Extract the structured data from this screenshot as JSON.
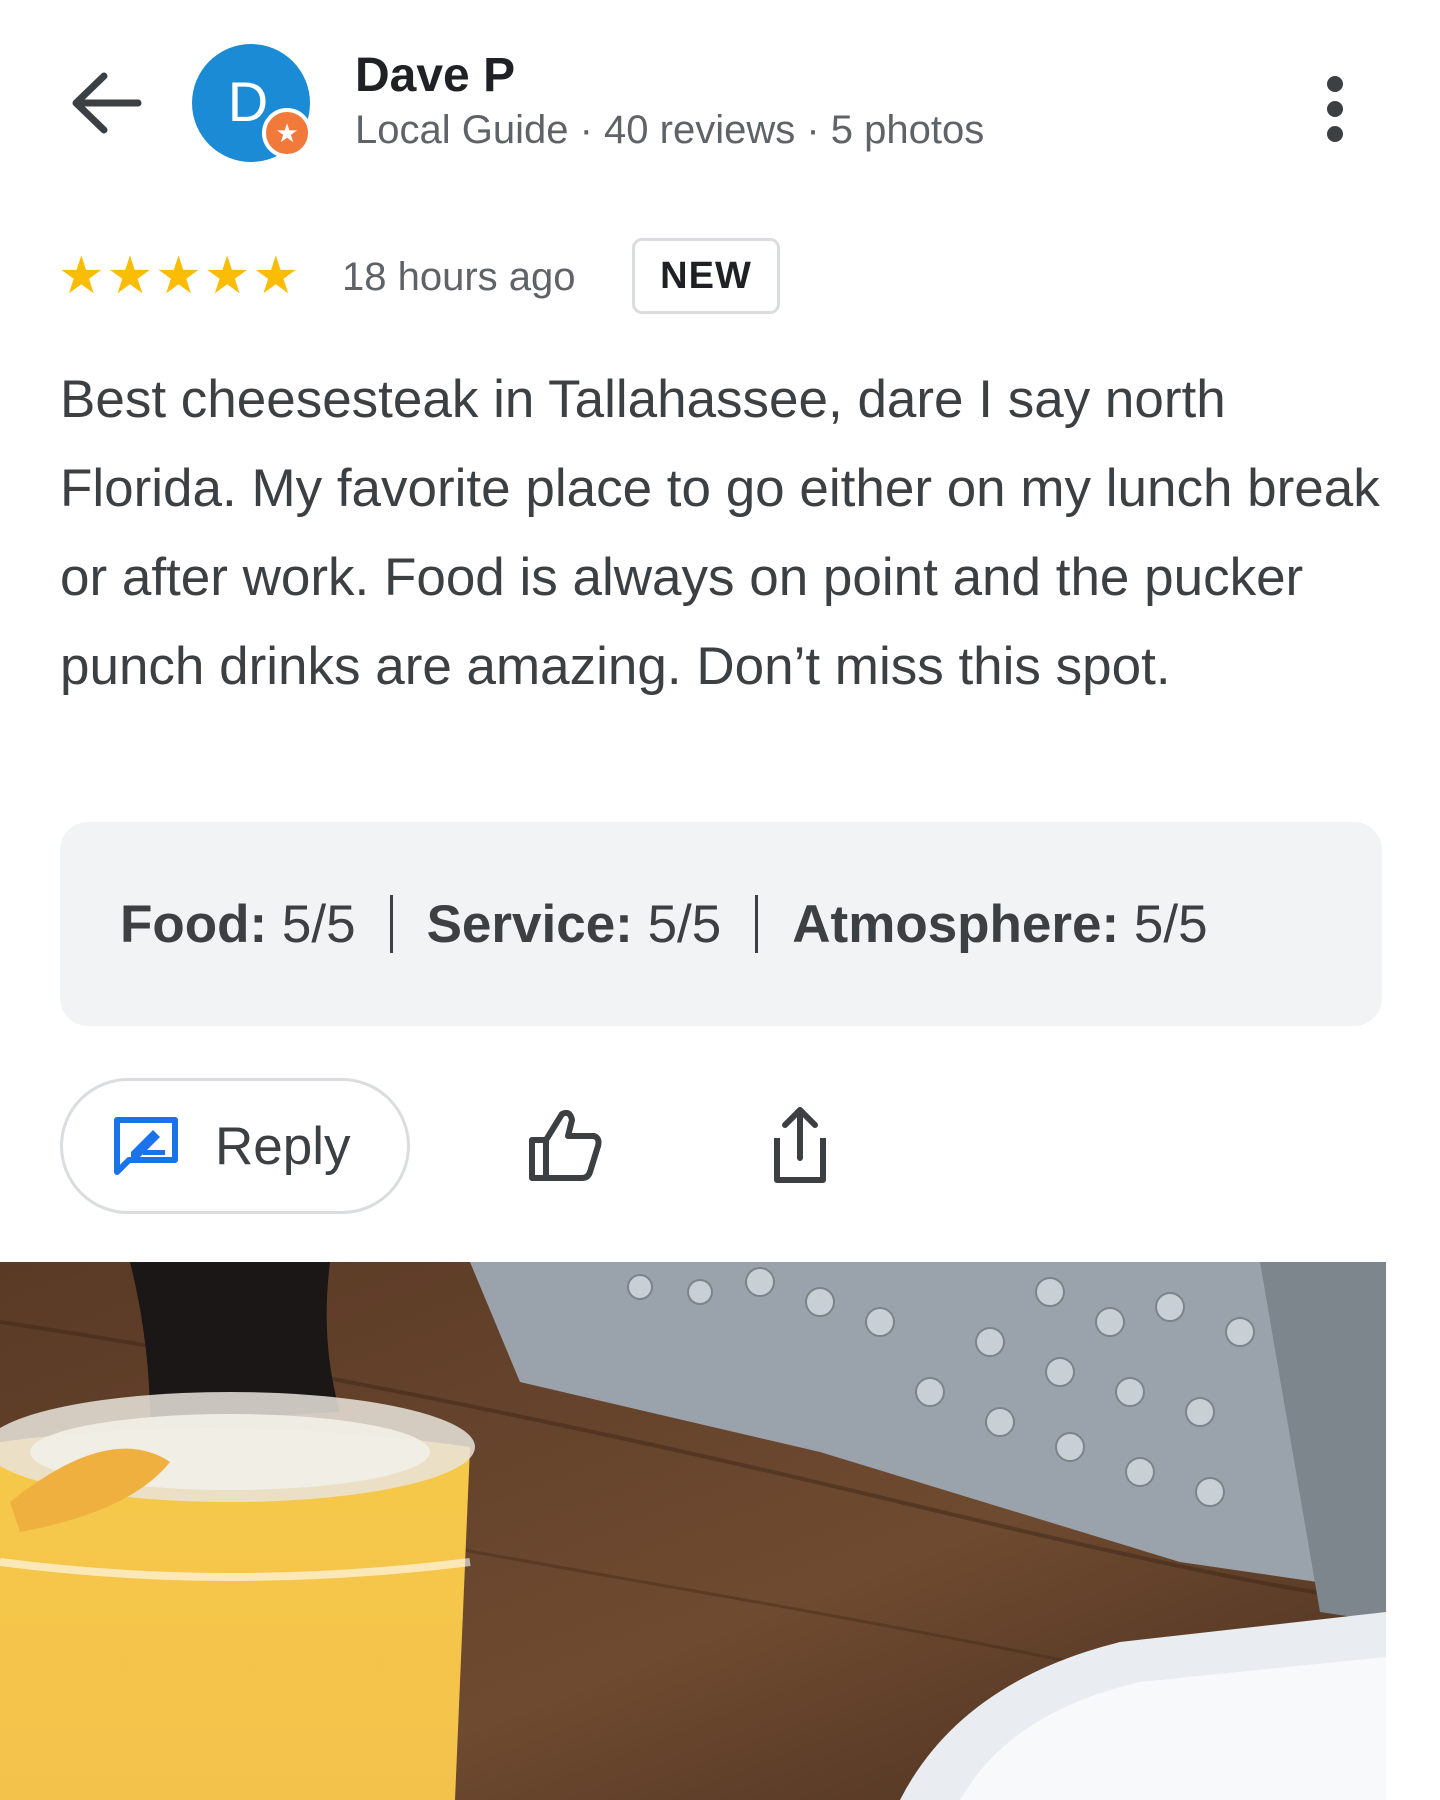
{
  "header": {
    "back_icon": "arrow-left-icon",
    "avatar_letter": "D",
    "avatar_color": "#1a8bd4",
    "local_guide_badge_icon": "star-badge-icon",
    "badge_color": "#f1793a",
    "reviewer_name": "Dave P",
    "reviewer_meta": "Local Guide · 40 reviews · 5 photos",
    "more_icon": "more-vert-icon"
  },
  "review": {
    "rating": 5,
    "max_rating": 5,
    "star_color": "#fbbc04",
    "time_ago": "18 hours ago",
    "badge": "NEW",
    "text": "Best cheesesteak in Tallahassee, dare I say north Florida. My favorite place to go either on my lunch break or after work. Food is always on point and the pucker punch drinks are amazing. Don’t miss this spot."
  },
  "sub_ratings": [
    {
      "label": "Food:",
      "value": "5/5"
    },
    {
      "label": "Service:",
      "value": "5/5"
    },
    {
      "label": "Atmosphere:",
      "value": "5/5"
    }
  ],
  "actions": {
    "reply_label": "Reply",
    "reply_icon": "reply-edit-icon",
    "like_icon": "thumbs-up-icon",
    "share_icon": "share-icon",
    "accent_color": "#1a73e8"
  },
  "photo": {
    "subject": "review-photo"
  }
}
